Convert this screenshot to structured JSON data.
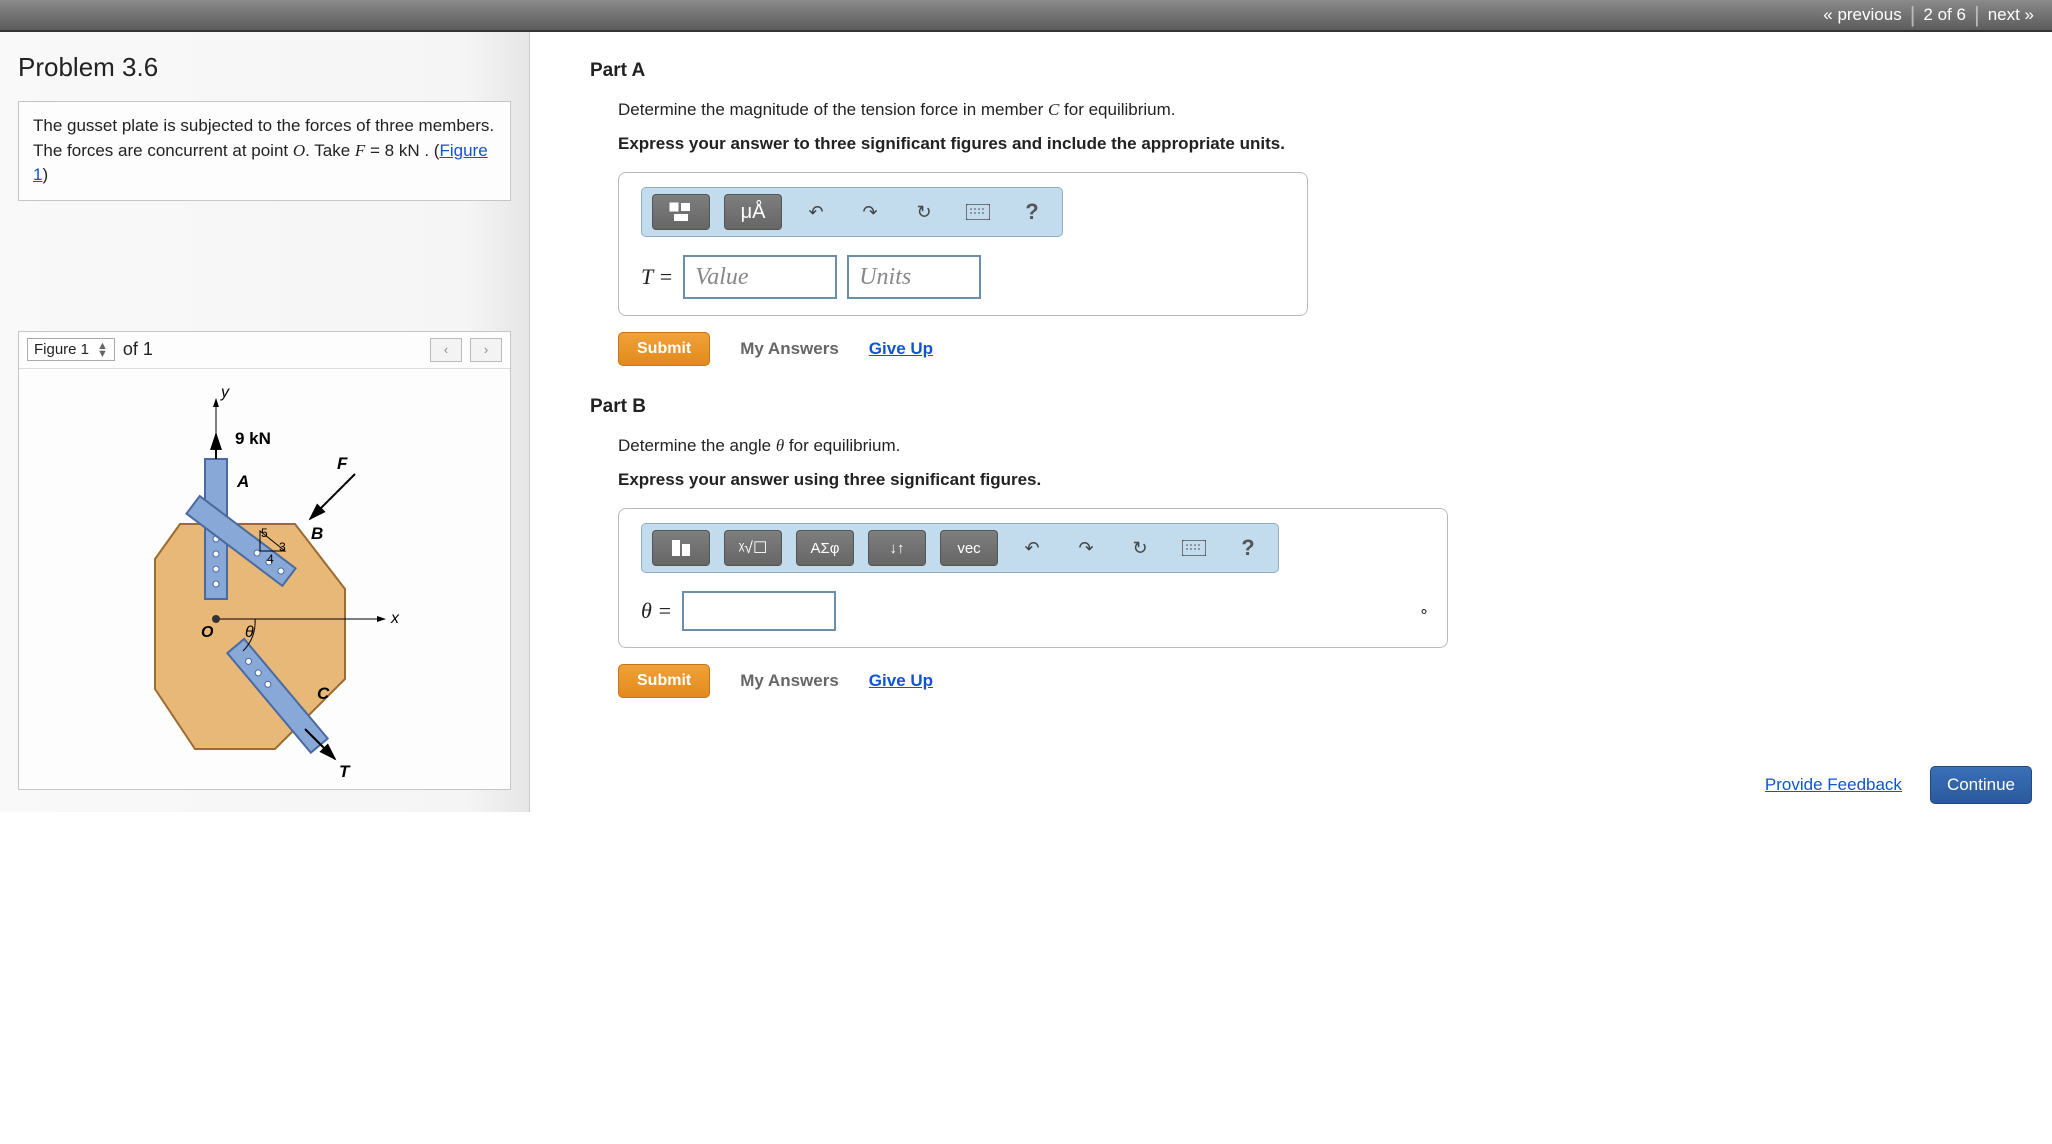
{
  "nav": {
    "prev": "« previous",
    "counter": "2 of 6",
    "next": "next »"
  },
  "problem": {
    "title": "Problem 3.6",
    "desc_pre": "The gusset plate is subjected to the forces of three members. The forces are concurrent at point ",
    "desc_O": "O",
    "desc_mid": ". Take ",
    "desc_F": "F",
    "desc_eq": " = 8  kN . (",
    "fig_link": "Figure 1",
    "desc_end": ")"
  },
  "figure": {
    "label": "Figure 1",
    "of": "of 1",
    "force": "9 kN",
    "pts": {
      "A": "A",
      "B": "B",
      "C": "C",
      "F": "F",
      "T": "T",
      "O": "O",
      "theta": "θ",
      "x": "x",
      "y": "y",
      "a5": "5",
      "a4": "4",
      "a3": "3"
    }
  },
  "partA": {
    "title": "Part A",
    "prompt_pre": "Determine the magnitude of the tension force in member ",
    "prompt_C": "C",
    "prompt_post": " for equilibrium.",
    "instr": "Express your answer to three significant figures and include the appropriate units.",
    "toolbar": {
      "units": "μÅ",
      "help": "?"
    },
    "var": "T =",
    "value_ph": "Value",
    "units_ph": "Units",
    "submit": "Submit",
    "myans": "My Answers",
    "giveup": "Give Up"
  },
  "partB": {
    "title": "Part B",
    "prompt_pre": "Determine the angle ",
    "prompt_th": "θ",
    "prompt_post": " for equilibrium.",
    "instr": "Express your answer using three significant figures.",
    "toolbar": {
      "greek": "ΑΣφ",
      "vec": "vec",
      "help": "?"
    },
    "var": "θ =",
    "unit_suffix": "∘",
    "submit": "Submit",
    "myans": "My Answers",
    "giveup": "Give Up"
  },
  "footer": {
    "feedback": "Provide Feedback",
    "continue": "Continue"
  }
}
